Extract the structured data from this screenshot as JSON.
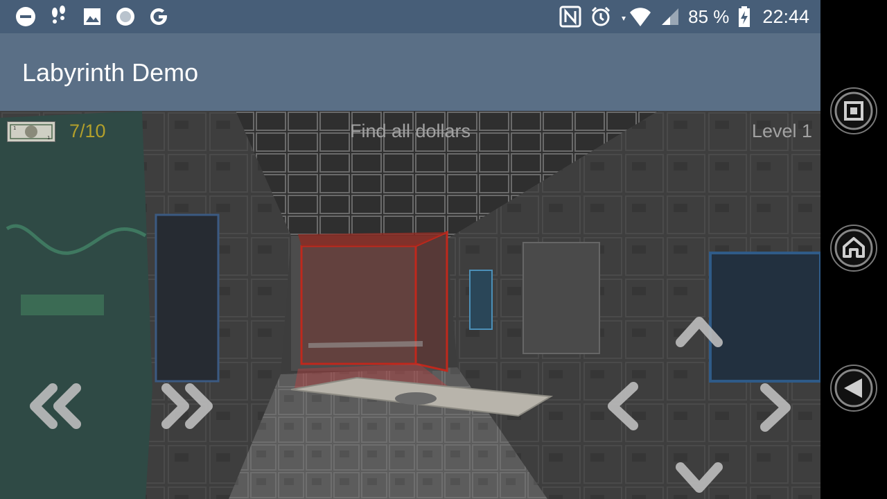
{
  "status_bar": {
    "battery_percent": "85 %",
    "time": "22:44",
    "icons_left": [
      "do-not-disturb-icon",
      "footsteps-icon",
      "gallery-icon",
      "record-icon",
      "google-icon"
    ],
    "icons_right": [
      "nfc-icon",
      "alarm-icon",
      "wifi-icon",
      "signal-icon",
      "battery-charging-icon"
    ]
  },
  "app_bar": {
    "title": "Labyrinth Demo"
  },
  "hud": {
    "score": "7/10",
    "objective": "Find all dollars",
    "level": "Level 1"
  },
  "controls": {
    "turn_left": "double-chevron-left-icon",
    "turn_right": "double-chevron-right-icon",
    "move_forward": "chevron-up-icon",
    "move_back": "chevron-down-icon",
    "strafe_left": "chevron-left-icon",
    "strafe_right": "chevron-right-icon"
  },
  "nav_bar": {
    "buttons": [
      "recents-icon",
      "home-icon",
      "back-icon"
    ]
  },
  "colors": {
    "status_bar": "#475e78",
    "app_bar": "#5a6f86",
    "score_text": "#b3a02b",
    "hud_text": "#a2a2a2",
    "target_highlight": "#c0281c"
  }
}
